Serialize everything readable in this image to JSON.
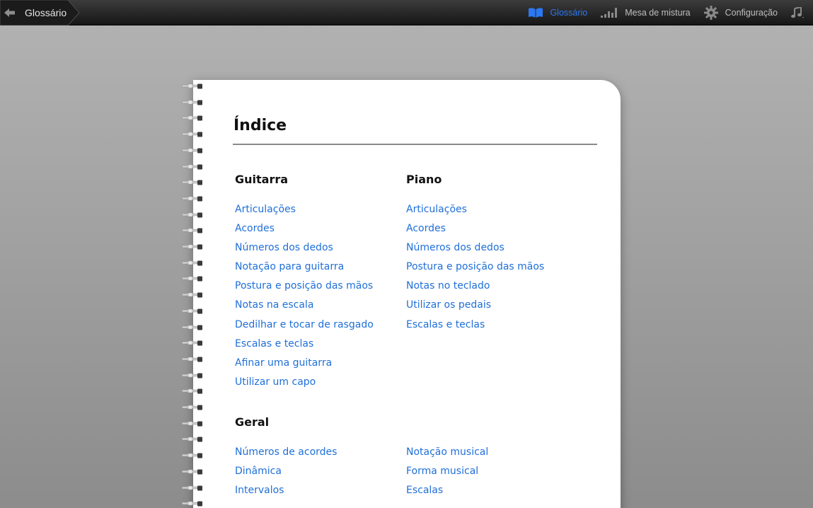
{
  "toolbar": {
    "back_label": "Glossário",
    "items": [
      {
        "label": "Glossário",
        "icon": "book-icon",
        "active": true
      },
      {
        "label": "Mesa de mistura",
        "icon": "mixer-icon",
        "active": false
      },
      {
        "label": "Configuração",
        "icon": "gear-icon",
        "active": false
      },
      {
        "label": "",
        "icon": "music-note-icon",
        "active": false
      }
    ],
    "colors": {
      "active": "#2b78f0",
      "inactive": "#bdbdbd"
    }
  },
  "notebook": {
    "title": "Índice",
    "guitarra": {
      "heading": "Guitarra",
      "links": [
        "Articulações",
        "Acordes",
        "Números dos dedos",
        "Notação para guitarra",
        "Postura e posição das mãos",
        "Notas na escala",
        "Dedilhar e tocar de rasgado",
        "Escalas e teclas",
        "Afinar uma guitarra",
        "Utilizar um capo"
      ]
    },
    "piano": {
      "heading": "Piano",
      "links": [
        "Articulações",
        "Acordes",
        "Números dos dedos",
        "Postura e posição das mãos",
        "Notas no teclado",
        "Utilizar os pedais",
        "Escalas e teclas"
      ]
    },
    "geral": {
      "heading": "Geral",
      "links_left": [
        "Números de acordes",
        "Dinâmica",
        "Intervalos"
      ],
      "links_right": [
        "Notação musical",
        "Forma musical",
        "Escalas"
      ]
    },
    "link_color": "#1f6fd8"
  }
}
